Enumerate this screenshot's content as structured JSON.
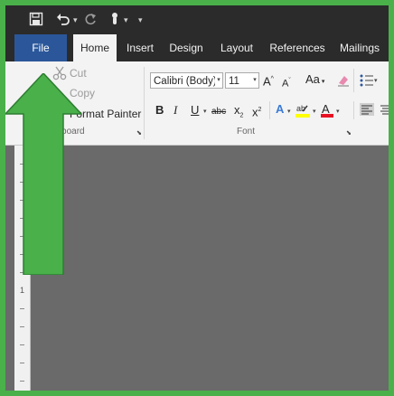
{
  "quick_access": {
    "save_icon": "save-icon",
    "undo_icon": "undo-icon",
    "redo_icon": "redo-icon",
    "touch_mode_icon": "touch-mode-icon",
    "customize_icon": "customize-qat-icon"
  },
  "tabs": [
    "File",
    "Home",
    "Insert",
    "Design",
    "Layout",
    "References",
    "Mailings"
  ],
  "clipboard": {
    "cut": "Cut",
    "copy": "Copy",
    "format_painter": "Format Painter",
    "group_label": "lipboard"
  },
  "font": {
    "font_name": "Calibri (Body)",
    "font_size": "11",
    "change_case": "Aa",
    "group_label": "Font"
  },
  "colors": {
    "accent_arrow": "#49b04a",
    "file_tab": "#2b579a",
    "title_bar": "#2b2b2b",
    "ribbon": "#f3f3f3",
    "highlight_color": "#ffff00",
    "font_color": "#e81123"
  },
  "ruler": {
    "marker": "1"
  }
}
